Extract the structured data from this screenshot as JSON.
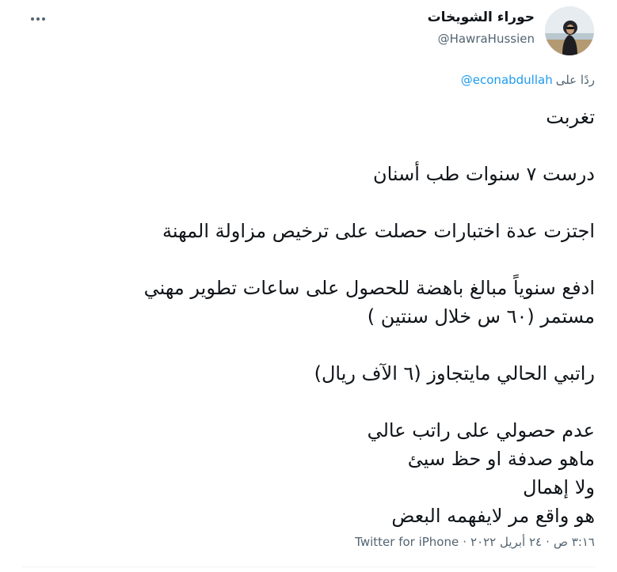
{
  "tweet": {
    "author": {
      "name": "حوراء الشويخات",
      "handle": "@HawraHussien"
    },
    "reply_prefix": "ردًا على",
    "reply_to": "@econabdullah",
    "lines": [
      "تغربت",
      "",
      "درست ٧ سنوات طب أسنان",
      "",
      "اجتزت عدة اختبارات حصلت على ترخيص مزاولة المهنة",
      "",
      "ادفع سنوياً مبالغ باهضة للحصول على ساعات تطوير مهني",
      "مستمر (٦٠ س خلال سنتين )",
      "",
      "راتبي الحالي مايتجاوز (٦ الآف ريال)",
      "",
      "عدم حصولي على راتب عالي",
      " ماهو صدفة او حظ سيئ",
      "ولا إهمال",
      "هو واقع مر لايفهمه البعض"
    ],
    "time": "٣:١٦ ص",
    "date": "٢٤ أبريل ٢٠٢٢",
    "source": "Twitter for iPhone",
    "separator": "·"
  },
  "icons": {
    "more": "more-horizontal-icon"
  }
}
